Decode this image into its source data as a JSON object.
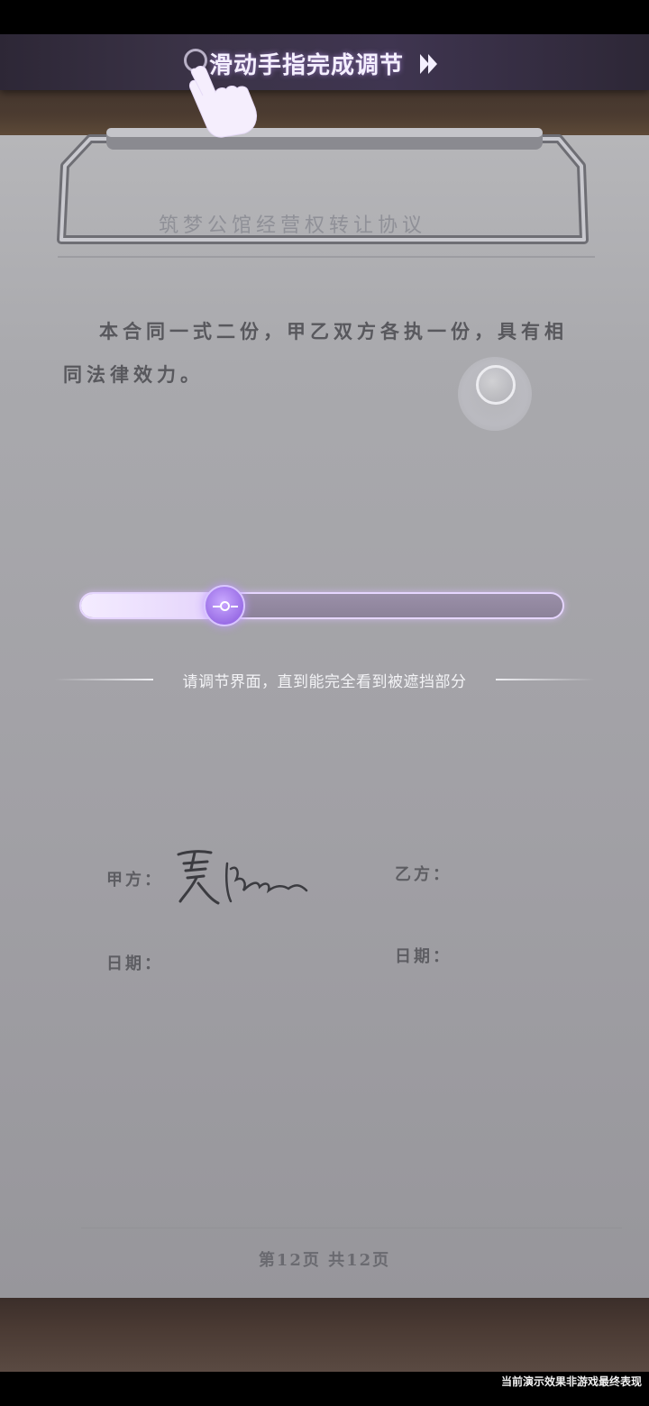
{
  "banner": {
    "instruction": "滑动手指完成调节"
  },
  "document": {
    "title": "筑梦公馆经营权转让协议",
    "body": "本合同一式二份，甲乙双方各执一份，具有相同法律效力。",
    "party_a_label": "甲方：",
    "party_b_label": "乙方：",
    "date_label_a": "日期：",
    "date_label_b": "日期：",
    "page_indicator": "第12页  共12页"
  },
  "slider": {
    "value_percent": 30,
    "hint": "请调节界面，直到能完全看到被遮挡部分"
  },
  "footer": {
    "disclaimer": "当前演示效果非游戏最终表现"
  },
  "colors": {
    "accent": "#b88cff",
    "paper": "#a9a9ad",
    "banner_bg": "#3b3347"
  },
  "icons": [
    "ring-icon",
    "fast-forward-icon",
    "pointing-hand-icon",
    "focus-circle-icon",
    "slider-thumb-icon"
  ]
}
